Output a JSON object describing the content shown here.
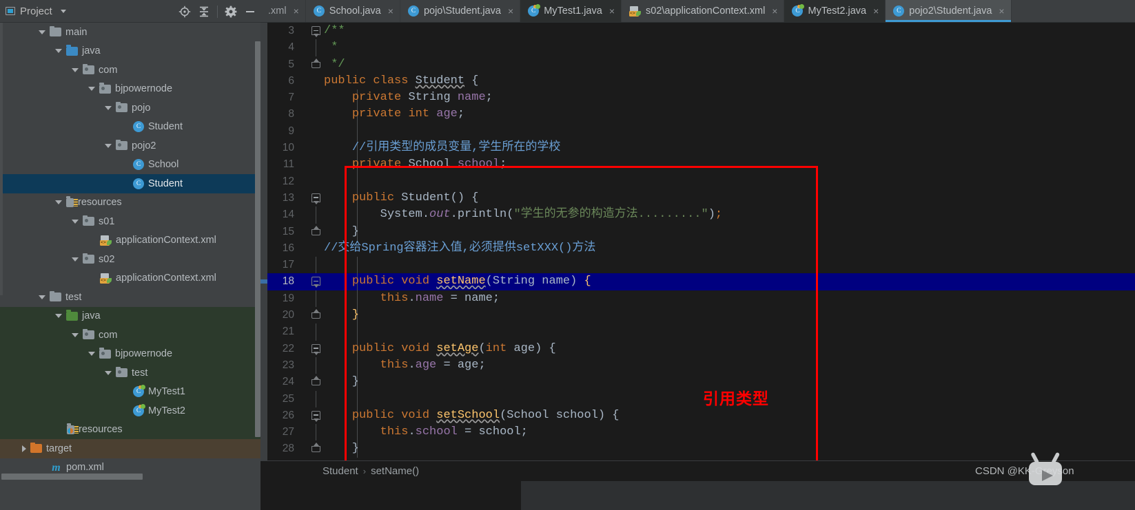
{
  "project_panel": {
    "title": "Project",
    "tools": [
      {
        "name": "locate-icon",
        "glyph": "locate"
      },
      {
        "name": "collapse-all-icon",
        "glyph": "collapse"
      },
      {
        "name": "settings-gear-icon",
        "glyph": "gear"
      },
      {
        "name": "hide-panel-icon",
        "glyph": "minus"
      }
    ],
    "tree": [
      {
        "label": "main",
        "indent": 2,
        "arrow": "down",
        "icon": "folder-grey",
        "zone": "",
        "selected": false
      },
      {
        "label": "java",
        "indent": 3,
        "arrow": "down",
        "icon": "folder-src",
        "zone": "",
        "selected": false
      },
      {
        "label": "com",
        "indent": 4,
        "arrow": "down",
        "icon": "folder-pkg",
        "zone": "",
        "selected": false
      },
      {
        "label": "bjpowernode",
        "indent": 5,
        "arrow": "down",
        "icon": "folder-pkg",
        "zone": "",
        "selected": false
      },
      {
        "label": "pojo",
        "indent": 6,
        "arrow": "down",
        "icon": "folder-pkg",
        "zone": "",
        "selected": false
      },
      {
        "label": "Student",
        "indent": 7,
        "arrow": "none",
        "icon": "class",
        "zone": "",
        "selected": false
      },
      {
        "label": "pojo2",
        "indent": 6,
        "arrow": "down",
        "icon": "folder-pkg",
        "zone": "",
        "selected": false
      },
      {
        "label": "School",
        "indent": 7,
        "arrow": "none",
        "icon": "class",
        "zone": "",
        "selected": false
      },
      {
        "label": "Student",
        "indent": 7,
        "arrow": "none",
        "icon": "class",
        "zone": "",
        "selected": true
      },
      {
        "label": "resources",
        "indent": 3,
        "arrow": "down",
        "icon": "folder-res",
        "zone": "",
        "selected": false
      },
      {
        "label": "s01",
        "indent": 4,
        "arrow": "down",
        "icon": "folder-pkg",
        "zone": "",
        "selected": false
      },
      {
        "label": "applicationContext.xml",
        "indent": 5,
        "arrow": "none",
        "icon": "xml",
        "zone": "",
        "selected": false
      },
      {
        "label": "s02",
        "indent": 4,
        "arrow": "down",
        "icon": "folder-pkg",
        "zone": "",
        "selected": false
      },
      {
        "label": "applicationContext.xml",
        "indent": 5,
        "arrow": "none",
        "icon": "xml",
        "zone": "",
        "selected": false
      },
      {
        "label": "test",
        "indent": 2,
        "arrow": "down",
        "icon": "folder-grey",
        "zone": "",
        "selected": false
      },
      {
        "label": "java",
        "indent": 3,
        "arrow": "down",
        "icon": "folder-green",
        "zone": "test",
        "selected": false
      },
      {
        "label": "com",
        "indent": 4,
        "arrow": "down",
        "icon": "folder-pkg",
        "zone": "test",
        "selected": false
      },
      {
        "label": "bjpowernode",
        "indent": 5,
        "arrow": "down",
        "icon": "folder-pkg",
        "zone": "test",
        "selected": false
      },
      {
        "label": "test",
        "indent": 6,
        "arrow": "down",
        "icon": "folder-pkg",
        "zone": "test",
        "selected": false
      },
      {
        "label": "MyTest1",
        "indent": 7,
        "arrow": "none",
        "icon": "class-test",
        "zone": "test",
        "selected": false
      },
      {
        "label": "MyTest2",
        "indent": 7,
        "arrow": "none",
        "icon": "class-test",
        "zone": "test",
        "selected": false
      },
      {
        "label": "resources",
        "indent": 3,
        "arrow": "none",
        "icon": "folder-res-test",
        "zone": "test",
        "selected": false
      },
      {
        "label": "target",
        "indent": 1,
        "arrow": "right",
        "icon": "folder-orange",
        "zone": "target",
        "selected": false
      },
      {
        "label": "pom.xml",
        "indent": 2,
        "arrow": "none",
        "icon": "maven",
        "zone": "",
        "selected": false
      }
    ]
  },
  "tabs": [
    {
      "label": ".xml",
      "icon": "none",
      "state": "dim",
      "close": "×"
    },
    {
      "label": "School.java",
      "icon": "class",
      "state": "normal",
      "close": "×"
    },
    {
      "label": "pojo\\Student.java",
      "icon": "class",
      "state": "normal",
      "close": "×"
    },
    {
      "label": "MyTest1.java",
      "icon": "classtest",
      "state": "dark",
      "close": "×"
    },
    {
      "label": "s02\\applicationContext.xml",
      "icon": "xml",
      "state": "normal",
      "close": "×"
    },
    {
      "label": "MyTest2.java",
      "icon": "classtest",
      "state": "dark",
      "close": "×"
    },
    {
      "label": "pojo2\\Student.java",
      "icon": "class",
      "state": "active",
      "close": "×"
    }
  ],
  "editor": {
    "first_line": 3,
    "highlighted_line": 18,
    "lines": [
      {
        "n": 3,
        "fold": "top",
        "guide": false,
        "indent": false,
        "tokens": [
          {
            "c": "cm",
            "t": "/**"
          }
        ]
      },
      {
        "n": 4,
        "fold": "",
        "guide": true,
        "indent": false,
        "tokens": [
          {
            "c": "cm",
            "t": " *"
          }
        ]
      },
      {
        "n": 5,
        "fold": "end",
        "guide": false,
        "indent": false,
        "tokens": [
          {
            "c": "cm",
            "t": " */"
          }
        ]
      },
      {
        "n": 6,
        "fold": "",
        "guide": false,
        "indent": false,
        "tokens": [
          {
            "c": "k",
            "t": "public "
          },
          {
            "c": "k",
            "t": "class "
          },
          {
            "c": "t wavy",
            "t": "Student"
          },
          {
            "c": "t",
            "t": " {"
          }
        ]
      },
      {
        "n": 7,
        "fold": "",
        "guide": false,
        "indent": true,
        "tokens": [
          {
            "c": "t",
            "t": "    "
          },
          {
            "c": "k",
            "t": "private "
          },
          {
            "c": "t",
            "t": "String "
          },
          {
            "c": "f",
            "t": "name"
          },
          {
            "c": "t",
            "t": ";"
          }
        ]
      },
      {
        "n": 8,
        "fold": "",
        "guide": false,
        "indent": true,
        "tokens": [
          {
            "c": "t",
            "t": "    "
          },
          {
            "c": "k",
            "t": "private "
          },
          {
            "c": "k",
            "t": "int "
          },
          {
            "c": "f",
            "t": "age"
          },
          {
            "c": "t",
            "t": ";"
          }
        ]
      },
      {
        "n": 9,
        "fold": "",
        "guide": false,
        "indent": true,
        "tokens": []
      },
      {
        "n": 10,
        "fold": "",
        "guide": false,
        "indent": true,
        "tokens": [
          {
            "c": "t",
            "t": "    "
          },
          {
            "c": "cl",
            "t": "//引用类型的成员变量,学生所在的学校"
          }
        ]
      },
      {
        "n": 11,
        "fold": "",
        "guide": false,
        "indent": true,
        "tokens": [
          {
            "c": "t",
            "t": "    "
          },
          {
            "c": "k",
            "t": "private "
          },
          {
            "c": "t",
            "t": "School "
          },
          {
            "c": "f",
            "t": "school"
          },
          {
            "c": "t",
            "t": ";"
          }
        ]
      },
      {
        "n": 12,
        "fold": "",
        "guide": false,
        "indent": true,
        "tokens": []
      },
      {
        "n": 13,
        "fold": "top",
        "guide": false,
        "indent": true,
        "tokens": [
          {
            "c": "t",
            "t": "    "
          },
          {
            "c": "k",
            "t": "public "
          },
          {
            "c": "t",
            "t": "Student() {"
          }
        ]
      },
      {
        "n": 14,
        "fold": "",
        "guide": true,
        "indent": true,
        "tokens": [
          {
            "c": "t",
            "t": "        System."
          },
          {
            "c": "sf",
            "t": "out"
          },
          {
            "c": "t",
            "t": ".println("
          },
          {
            "c": "s",
            "t": "\"学生的无参的构造方法.........\""
          },
          {
            "c": "t",
            "t": ")"
          },
          {
            "c": "k",
            "t": ";"
          }
        ]
      },
      {
        "n": 15,
        "fold": "end",
        "guide": false,
        "indent": true,
        "tokens": [
          {
            "c": "t",
            "t": "    }"
          }
        ]
      },
      {
        "n": 16,
        "fold": "",
        "guide": false,
        "indent": false,
        "tokens": [
          {
            "c": "cl",
            "t": "//交给Spring容器注入值,必须提供setXXX()方法"
          }
        ]
      },
      {
        "n": 17,
        "fold": "",
        "guide": true,
        "indent": true,
        "tokens": []
      },
      {
        "n": 18,
        "fold": "top",
        "guide": false,
        "indent": true,
        "tokens": [
          {
            "c": "t",
            "t": "    "
          },
          {
            "c": "k",
            "t": "public "
          },
          {
            "c": "k",
            "t": "void "
          },
          {
            "c": "m wavy",
            "t": "setName"
          },
          {
            "c": "t",
            "t": "("
          },
          {
            "c": "t",
            "t": "String name"
          },
          {
            "c": "t",
            "t": ") "
          },
          {
            "c": "yb",
            "t": "{"
          }
        ]
      },
      {
        "n": 19,
        "fold": "",
        "guide": true,
        "indent": true,
        "tokens": [
          {
            "c": "t",
            "t": "        "
          },
          {
            "c": "k",
            "t": "this"
          },
          {
            "c": "t",
            "t": "."
          },
          {
            "c": "f",
            "t": "name"
          },
          {
            "c": "t",
            "t": " = name;"
          }
        ]
      },
      {
        "n": 20,
        "fold": "end",
        "guide": false,
        "indent": true,
        "tokens": [
          {
            "c": "t",
            "t": "    "
          },
          {
            "c": "yb",
            "t": "}"
          }
        ]
      },
      {
        "n": 21,
        "fold": "",
        "guide": true,
        "indent": true,
        "tokens": []
      },
      {
        "n": 22,
        "fold": "top",
        "guide": false,
        "indent": true,
        "tokens": [
          {
            "c": "t",
            "t": "    "
          },
          {
            "c": "k",
            "t": "public "
          },
          {
            "c": "k",
            "t": "void "
          },
          {
            "c": "m wavy",
            "t": "setAge"
          },
          {
            "c": "t",
            "t": "("
          },
          {
            "c": "k",
            "t": "int"
          },
          {
            "c": "t",
            "t": " age) {"
          }
        ]
      },
      {
        "n": 23,
        "fold": "",
        "guide": true,
        "indent": true,
        "tokens": [
          {
            "c": "t",
            "t": "        "
          },
          {
            "c": "k",
            "t": "this"
          },
          {
            "c": "t",
            "t": "."
          },
          {
            "c": "f",
            "t": "age"
          },
          {
            "c": "t",
            "t": " = age;"
          }
        ]
      },
      {
        "n": 24,
        "fold": "end",
        "guide": false,
        "indent": true,
        "tokens": [
          {
            "c": "t",
            "t": "    }"
          }
        ]
      },
      {
        "n": 25,
        "fold": "",
        "guide": true,
        "indent": true,
        "tokens": []
      },
      {
        "n": 26,
        "fold": "top",
        "guide": false,
        "indent": true,
        "tokens": [
          {
            "c": "t",
            "t": "    "
          },
          {
            "c": "k",
            "t": "public "
          },
          {
            "c": "k",
            "t": "void "
          },
          {
            "c": "m wavy",
            "t": "setSchool"
          },
          {
            "c": "t",
            "t": "(School school) {"
          }
        ]
      },
      {
        "n": 27,
        "fold": "",
        "guide": true,
        "indent": true,
        "tokens": [
          {
            "c": "t",
            "t": "        "
          },
          {
            "c": "k",
            "t": "this"
          },
          {
            "c": "t",
            "t": "."
          },
          {
            "c": "f",
            "t": "school"
          },
          {
            "c": "t",
            "t": " = school;"
          }
        ]
      },
      {
        "n": 28,
        "fold": "end",
        "guide": false,
        "indent": true,
        "tokens": [
          {
            "c": "t",
            "t": "    }"
          }
        ]
      }
    ],
    "annotation_label": "引用类型",
    "annotation_color": "#ff0000"
  },
  "breadcrumb": {
    "class": "Student",
    "separator": "›",
    "member": "setName()"
  },
  "watermark": {
    "text": "CSDN @KK-Greyson"
  }
}
